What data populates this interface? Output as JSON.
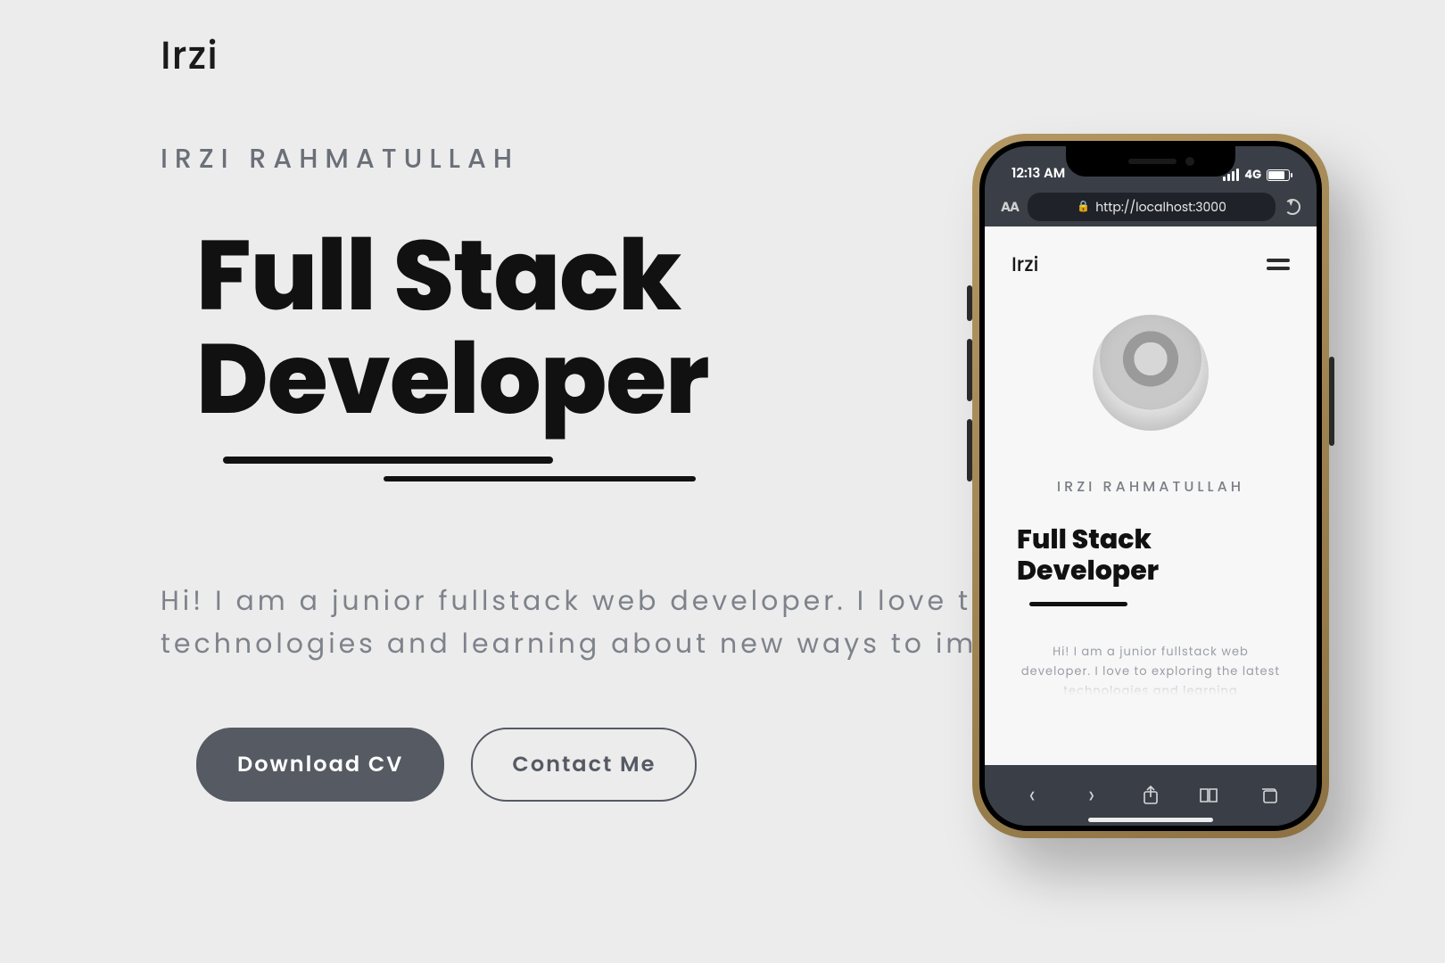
{
  "desktop": {
    "logo": "Irzi",
    "name": "IRZI RAHMATULLAH",
    "hero_line1": "Full Stack",
    "hero_line2": "Developer",
    "intro_line1": "Hi! I am a junior fullstack web developer. I love to",
    "intro_line2": "technologies and learning about new ways to impr",
    "buttons": {
      "download": "Download CV",
      "contact": "Contact Me"
    }
  },
  "phone": {
    "status": {
      "time": "12:13 AM",
      "network": "4G"
    },
    "urlbar": {
      "aa": "AA",
      "url": "http://localhost:3000"
    },
    "page": {
      "logo": "Irzi",
      "name": "IRZI RAHMATULLAH",
      "hero_line1": "Full Stack",
      "hero_line2": "Developer",
      "intro": "Hi! I am a junior fullstack web developer. I love to exploring the latest technologies and learning"
    }
  }
}
